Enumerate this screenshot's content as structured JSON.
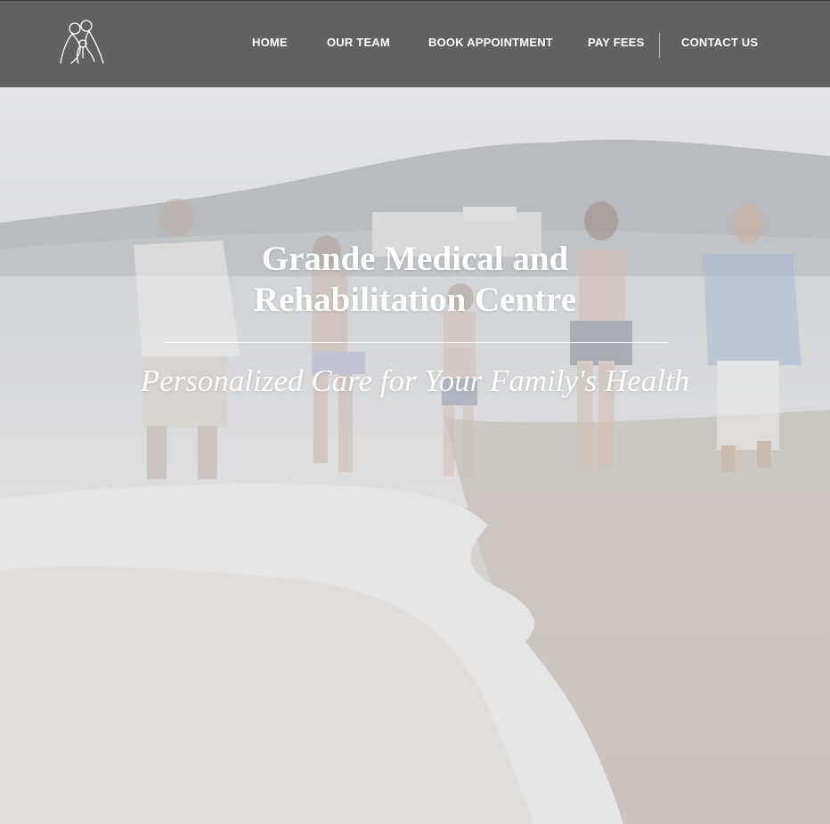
{
  "header": {
    "nav": [
      {
        "label": "HOME"
      },
      {
        "label": "OUR TEAM"
      },
      {
        "label": "BOOK APPOINTMENT"
      },
      {
        "label": "PAY FEES"
      },
      {
        "label": "CONTACT US"
      }
    ]
  },
  "hero": {
    "title": "Grande Medical and Rehabilitation Centre",
    "tagline": "Personalized Care for Your Family's Health"
  },
  "colors": {
    "header_bg": "#5c5c5c",
    "text": "#ffffff"
  },
  "icons": {
    "logo": "family-logo-icon"
  }
}
